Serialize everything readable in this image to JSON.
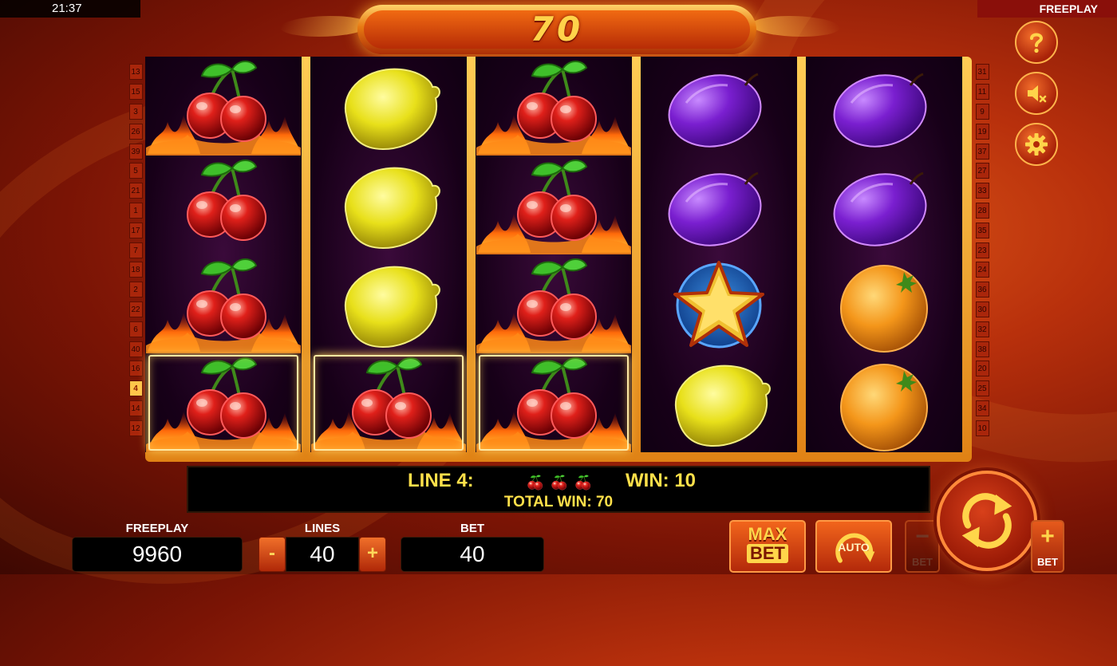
{
  "status_bar": {
    "clock": "21:37",
    "mode": "FREEPLAY"
  },
  "win_display": {
    "amount": "70"
  },
  "side_buttons": [
    {
      "name": "help-button",
      "icon": "question-mark-icon"
    },
    {
      "name": "sound-button",
      "icon": "speaker-muted-icon"
    },
    {
      "name": "settings-button",
      "icon": "gear-icon"
    }
  ],
  "paylines": {
    "left": [
      "13",
      "15",
      "3",
      "26",
      "39",
      "5",
      "21",
      "1",
      "17",
      "7",
      "18",
      "2",
      "22",
      "6",
      "40",
      "16",
      "4",
      "14",
      "12"
    ],
    "right": [
      "31",
      "11",
      "9",
      "19",
      "37",
      "27",
      "33",
      "28",
      "35",
      "23",
      "24",
      "36",
      "30",
      "32",
      "38",
      "20",
      "25",
      "34",
      "10"
    ],
    "active": "4"
  },
  "reels": [
    {
      "symbols": [
        "cherry-fire",
        "cherry",
        "cherry-fire",
        "cherry-fire"
      ]
    },
    {
      "symbols": [
        "lemon",
        "lemon",
        "lemon",
        "cherry-fire"
      ]
    },
    {
      "symbols": [
        "cherry-fire",
        "cherry-fire",
        "cherry-fire",
        "cherry-fire"
      ]
    },
    {
      "symbols": [
        "plum",
        "plum",
        "star",
        "lemon"
      ]
    },
    {
      "symbols": [
        "plum",
        "plum",
        "orange",
        "orange"
      ]
    }
  ],
  "winning_row": 3,
  "winning_reels": 3,
  "info": {
    "line_label": "LINE 4:",
    "win_label": "WIN: 10",
    "total_win": "TOTAL WIN: 70",
    "line_symbols": [
      "cherry",
      "cherry",
      "cherry"
    ]
  },
  "controls": {
    "balance_label": "FREEPLAY",
    "balance_value": "9960",
    "lines_label": "LINES",
    "lines_value": "40",
    "lines_minus": "-",
    "lines_plus": "+",
    "bet_label": "BET",
    "bet_value": "40",
    "max_bet_top": "MAX",
    "max_bet_bottom": "BET",
    "auto_label": "AUTO",
    "bet_minus_symbol": "−",
    "bet_minus_label": "BET",
    "bet_plus_symbol": "+",
    "bet_plus_label": "BET"
  },
  "colors": {
    "accent": "#ffd54a",
    "frame": "#ffcd55",
    "reel_bg": "#170018"
  }
}
